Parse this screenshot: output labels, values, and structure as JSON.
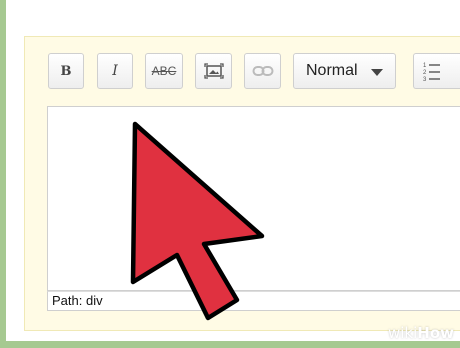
{
  "toolbar": {
    "bold_label": "B",
    "italic_label": "I",
    "strike_label": "ABC",
    "image_icon": "image-icon",
    "link_icon": "link-icon",
    "format_select": {
      "selected": "Normal"
    },
    "list_icon": "numbered-list-icon"
  },
  "editor": {
    "status_bar": "Path: div"
  },
  "cursor": {
    "icon": "mouse-pointer-arrow",
    "color": "#e03140"
  },
  "watermark": {
    "part1": "wiki",
    "part2": "How"
  },
  "colors": {
    "background": "#a6c991",
    "panel": "#fffbe5",
    "cursor": "#e03140"
  }
}
